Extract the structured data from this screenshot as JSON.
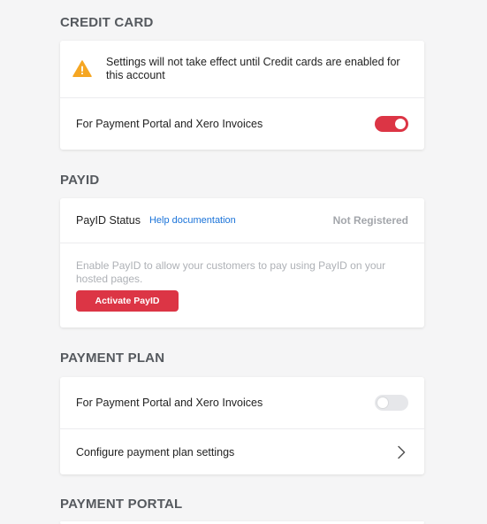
{
  "credit_card": {
    "title": "CREDIT CARD",
    "warning_text": "Settings will not take effect until Credit cards are enabled for this account",
    "toggle_label": "For Payment Portal and Xero Invoices",
    "toggle_state": "on"
  },
  "payid": {
    "title": "PAYID",
    "status_label": "PayID Status",
    "help_link": "Help documentation",
    "status_value": "Not Registered",
    "description": "Enable PayID to allow your customers to pay using PayID on your hosted pages.",
    "activate_button": "Activate PayID"
  },
  "payment_plan": {
    "title": "PAYMENT PLAN",
    "toggle_label": "For Payment Portal and Xero Invoices",
    "toggle_state": "off",
    "configure_label": "Configure payment plan settings"
  },
  "payment_portal": {
    "title": "PAYMENT PORTAL"
  },
  "colors": {
    "accent": "#dc3545",
    "warning": "#f5a623",
    "link": "#1a73d9",
    "muted": "#a3a6ab"
  },
  "icons": {
    "warning": "warning-triangle-icon",
    "chevron": "chevron-right-icon"
  }
}
